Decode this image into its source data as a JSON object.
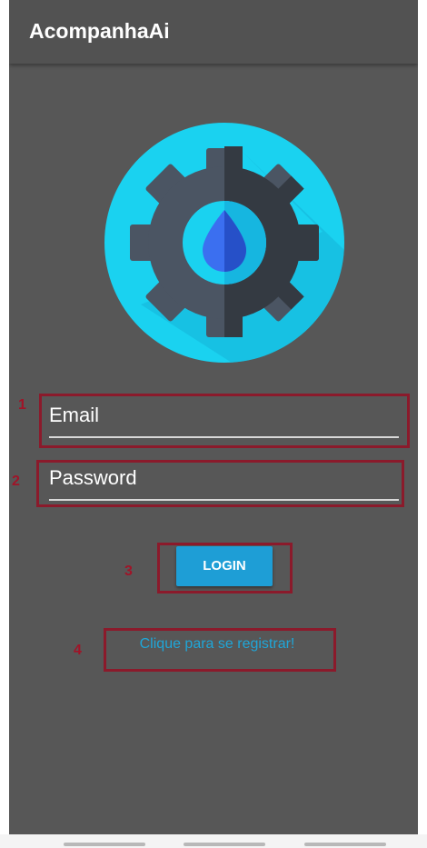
{
  "app": {
    "title": "AcompanhaAi"
  },
  "form": {
    "email_placeholder": "Email",
    "password_placeholder": "Password",
    "login_label": "LOGIN",
    "register_link": "Clique para se registrar!"
  },
  "annotations": [
    "1",
    "2",
    "3",
    "4"
  ],
  "icons": {
    "logo": "gear-water-drop-icon"
  },
  "colors": {
    "background": "#575757",
    "accent": "#1e9ed6",
    "annotation": "#8b1a2b",
    "logo_circle": "#1ad2f0"
  }
}
